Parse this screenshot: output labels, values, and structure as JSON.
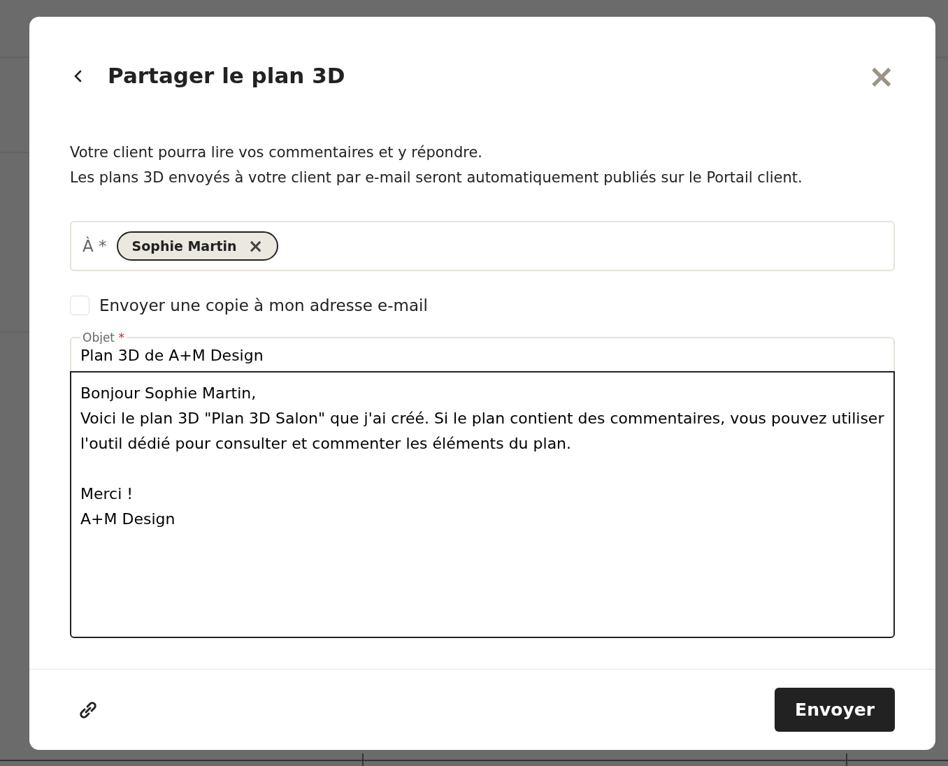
{
  "dialog": {
    "title": "Partager le plan 3D",
    "close": "×"
  },
  "intro": [
    "Votre client pourra lire vos commentaires et y répondre.",
    "Les plans 3D envoyés à votre client par e-mail seront automatiquement publiés sur le Portail client."
  ],
  "recipients": {
    "label": "À *",
    "chips": [
      {
        "name": "Sophie Martin",
        "remove": "×"
      }
    ]
  },
  "copy_checkbox": {
    "label": "Envoyer une copie à mon adresse e-mail",
    "checked": false
  },
  "subject": {
    "label": "Objet",
    "required_mark": "*",
    "value": "Plan 3D de A+M Design"
  },
  "message": {
    "value": "Bonjour Sophie Martin,\nVoici le plan 3D \"Plan 3D Salon\" que j'ai créé. Si le plan contient des commentaires, vous pouvez utiliser l'outil dédié pour consulter et commenter les éléments du plan.\n\nMerci !\nA+M Design"
  },
  "footer": {
    "send_button": "Envoyer"
  }
}
